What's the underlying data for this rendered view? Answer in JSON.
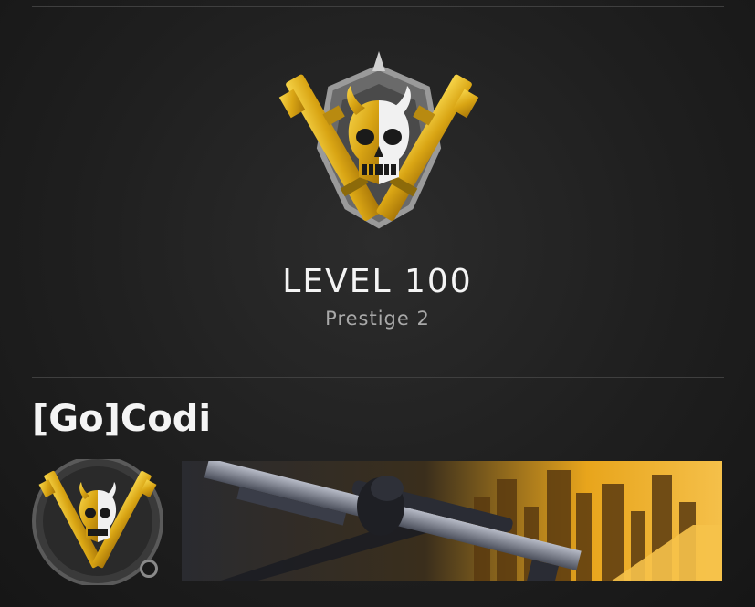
{
  "profile": {
    "level_label": "LEVEL 100",
    "prestige_label": "Prestige 2",
    "gamertag": "[Go]Codi"
  },
  "icons": {
    "large_emblem": "prestige-emblem-icon",
    "small_emblem": "player-emblem-icon",
    "status": "status-indicator-icon",
    "calling_card": "calling-card-image"
  },
  "colors": {
    "gold": "#e8b71c",
    "background": "#1f1f1f",
    "text_primary": "#f4f4f4",
    "text_secondary": "#a9a9a9"
  }
}
